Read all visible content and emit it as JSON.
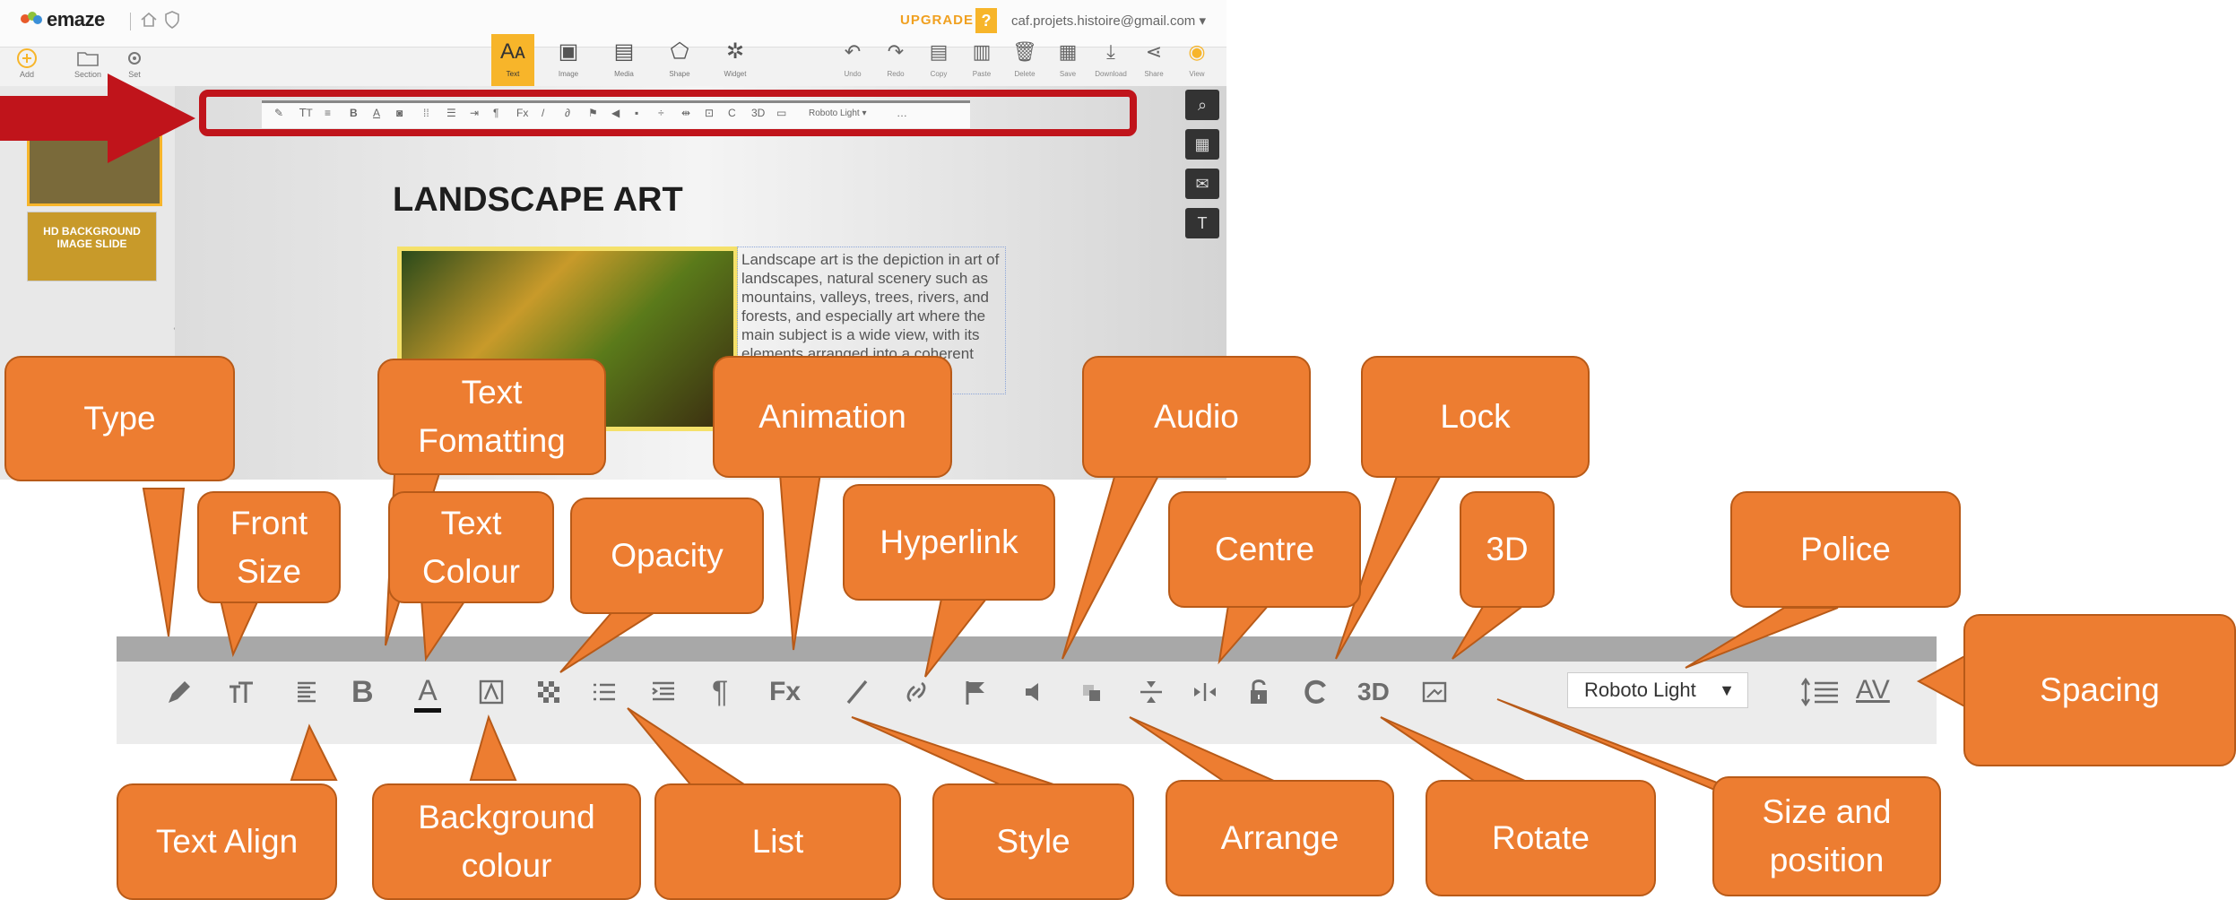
{
  "app": {
    "logo": "emaze",
    "upgrade": "UPGRADE",
    "help": "?",
    "email": "caf.projets.histoire@gmail.com ▾",
    "left_nav": [
      "Add",
      "Section",
      "Set"
    ],
    "center_tools": [
      {
        "label": "Text",
        "glyph": "Aᴀ",
        "active": true
      },
      {
        "label": "Image",
        "glyph": "▣"
      },
      {
        "label": "Media",
        "glyph": "▤"
      },
      {
        "label": "Shape",
        "glyph": "⬠"
      },
      {
        "label": "Widget",
        "glyph": "✲"
      }
    ],
    "right_tools": [
      {
        "label": "Undo",
        "glyph": "↶"
      },
      {
        "label": "Redo",
        "glyph": "↷"
      },
      {
        "label": "Copy",
        "glyph": "▤"
      },
      {
        "label": "Paste",
        "glyph": "▥"
      },
      {
        "label": "Delete",
        "glyph": "🗑"
      },
      {
        "label": "Save",
        "glyph": "▦"
      },
      {
        "label": "Download",
        "glyph": "⤓"
      },
      {
        "label": "Share",
        "glyph": "⋖"
      },
      {
        "label": "View",
        "glyph": "◉"
      }
    ],
    "thumb2_text": "HD BACKGROUND IMAGE SLIDE",
    "mini_toolbar_font": "Roboto Light ▾",
    "slide_title": "LANDSCAPE ART",
    "slide_text": "Landscape art is the depiction in art of landscapes, natural scenery such as mountains, valleys, trees, rivers, and forests, and especially art where the main subject is a wide view, with its elements arranged into a coherent"
  },
  "toolbar": {
    "bold": "B",
    "font_color_letter": "A",
    "paragraph": "¶",
    "fx": "Fx",
    "three_d": "3D",
    "font_select": "Roboto Light",
    "font_caret": "▼",
    "spacing_glyph": "AV"
  },
  "callouts": {
    "type": "Type",
    "text_formatting": "Text Fomatting",
    "animation": "Animation",
    "audio": "Audio",
    "lock": "Lock",
    "front_size": "Front Size",
    "text_colour": "Text Colour",
    "opacity": "Opacity",
    "hyperlink": "Hyperlink",
    "centre": "Centre",
    "three_d": "3D",
    "police": "Police",
    "spacing": "Spacing",
    "text_align": "Text Align",
    "background_colour": "Background colour",
    "list": "List",
    "style": "Style",
    "arrange": "Arrange",
    "rotate": "Rotate",
    "size_and_position": "Size and position"
  },
  "colors": {
    "callout": "#ed7d31",
    "accent": "#f7b52a",
    "frame": "#c0141b"
  }
}
